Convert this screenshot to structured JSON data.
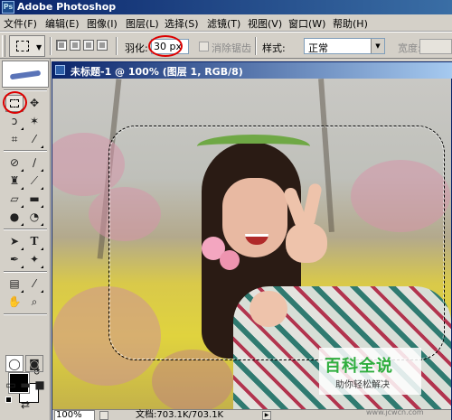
{
  "titlebar": {
    "icon": "Ps",
    "title": "Adobe Photoshop"
  },
  "menu": {
    "items": [
      "文件(F)",
      "编辑(E)",
      "图像(I)",
      "图层(L)",
      "选择(S)",
      "滤镜(T)",
      "视图(V)",
      "窗口(W)",
      "帮助(H)"
    ]
  },
  "options": {
    "feather_label": "羽化:",
    "feather_value": "30 px",
    "antialias_label": "消除锯齿",
    "style_label": "样式:",
    "style_value": "正常",
    "width_label": "宽度:"
  },
  "document": {
    "title": "未标题-1 @ 100% (图层 1, RGB/8)",
    "zoom": "100%",
    "info": "文档:703.1K/703.1K"
  },
  "toolbox": {
    "tools": [
      "rect-marquee",
      "move",
      "lasso",
      "magic-wand",
      "crop",
      "slice",
      "healing-brush",
      "brush",
      "clone-stamp",
      "history-brush",
      "eraser",
      "gradient",
      "blur",
      "dodge",
      "path-selection",
      "type",
      "pen",
      "custom-shape",
      "notes",
      "eyedropper",
      "hand",
      "zoom"
    ],
    "type_glyph": "T",
    "foreground_color": "#000000",
    "background_color": "#ffffff"
  },
  "watermark": {
    "title": "百科全说",
    "subtitle": "助你轻松解决",
    "url": "www.jcwcn.com"
  },
  "colors": {
    "titlebar_start": "#0a246a",
    "titlebar_end": "#3a6ea5",
    "annotation_red": "#dd0000",
    "watermark_green": "#2fae3e"
  }
}
